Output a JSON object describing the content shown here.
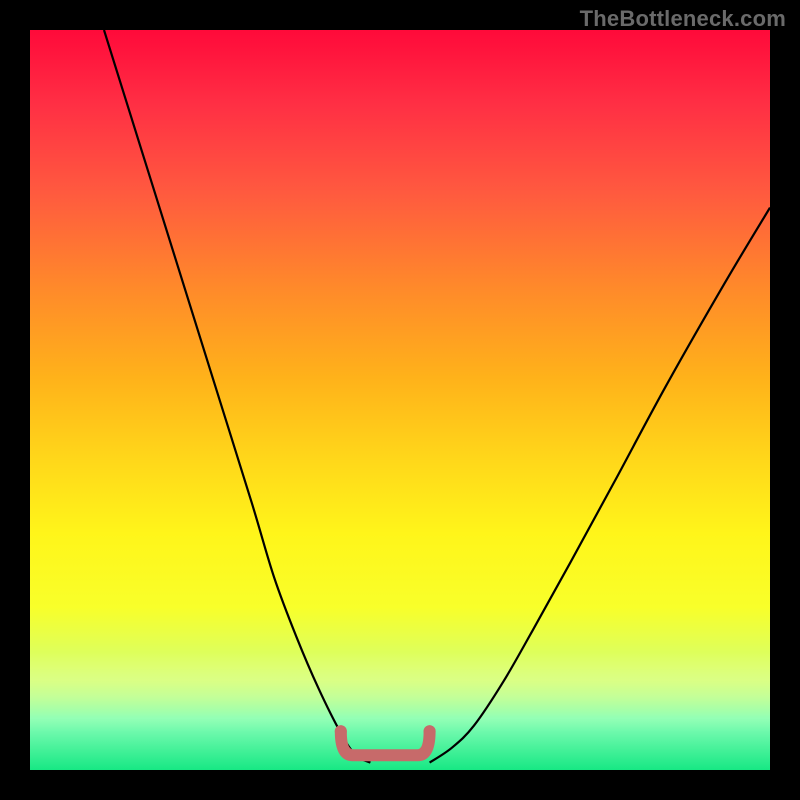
{
  "watermark": "TheBottleneck.com",
  "chart_data": {
    "type": "line",
    "title": "",
    "xlabel": "",
    "ylabel": "",
    "xlim": [
      0,
      100
    ],
    "ylim": [
      0,
      100
    ],
    "grid": false,
    "legend": false,
    "series": [
      {
        "name": "left-curve",
        "x": [
          10,
          15,
          20,
          25,
          30,
          33,
          36,
          39,
          42,
          44,
          46
        ],
        "values": [
          100,
          84,
          68,
          52,
          36,
          26,
          18,
          11,
          5,
          2,
          1
        ]
      },
      {
        "name": "right-curve",
        "x": [
          54,
          57,
          60,
          64,
          68,
          73,
          79,
          86,
          94,
          100
        ],
        "values": [
          1,
          3,
          6,
          12,
          19,
          28,
          39,
          52,
          66,
          76
        ]
      }
    ],
    "marker": {
      "name": "flat-bottom-bracket",
      "x_range": [
        42,
        54
      ],
      "y": 2,
      "color": "#c76a6a"
    },
    "background_gradient": [
      "#ff0a3a",
      "#ffd71a",
      "#fff51a",
      "#17e884"
    ]
  }
}
